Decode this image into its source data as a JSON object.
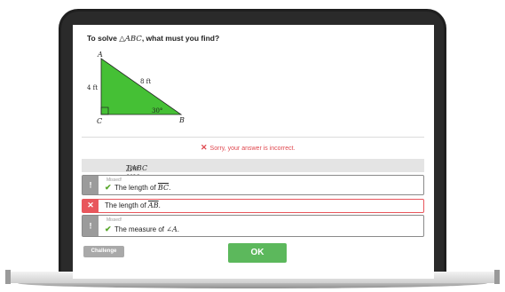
{
  "question": {
    "prefix": "To solve ",
    "math": "△ABC",
    "suffix": ", what must you find?"
  },
  "figure": {
    "vertex_a": "A",
    "vertex_b": "B",
    "vertex_c": "C",
    "side_ca": "4 ft",
    "side_ab": "8 ft",
    "angle_b": "30°",
    "fill_color": "#45c035"
  },
  "feedback": {
    "icon": "close-icon",
    "text": "Sorry, your answer is incorrect.",
    "color": "#e0484f"
  },
  "answers": {
    "area": {
      "prefix": "The area of ",
      "math": "△ABC",
      "suffix": "."
    },
    "bc": {
      "flag": "!",
      "missed": "Missed!",
      "prefix": "The length of ",
      "math": "BC",
      "suffix": "."
    },
    "ab": {
      "flag": "✕",
      "prefix": "The length of ",
      "math": "AB",
      "suffix": "."
    },
    "angle_a": {
      "flag": "!",
      "missed": "Missed!",
      "prefix": "The measure of ",
      "math": "∠A",
      "suffix": "."
    }
  },
  "buttons": {
    "challenge": "Challenge",
    "ok": "OK"
  },
  "colors": {
    "correct": "#5aa82e",
    "wrong": "#e8565c",
    "ok_button": "#5cb85c"
  }
}
